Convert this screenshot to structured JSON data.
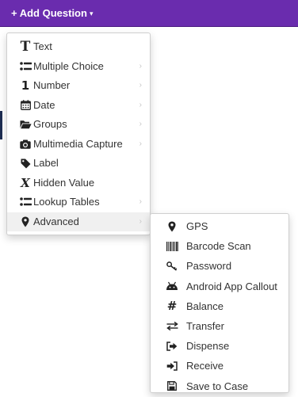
{
  "toolbar": {
    "add_question_label": "+ Add Question",
    "caret": "▾",
    "bar_color": "#6a2cae"
  },
  "menu": {
    "items": [
      {
        "label": "Text",
        "icon": "text-icon",
        "has_submenu": false
      },
      {
        "label": "Multiple Choice",
        "icon": "list-icon",
        "has_submenu": true
      },
      {
        "label": "Number",
        "icon": "number-icon",
        "has_submenu": true
      },
      {
        "label": "Date",
        "icon": "calendar-icon",
        "has_submenu": true
      },
      {
        "label": "Groups",
        "icon": "folder-open-icon",
        "has_submenu": true
      },
      {
        "label": "Multimedia Capture",
        "icon": "camera-icon",
        "has_submenu": true
      },
      {
        "label": "Label",
        "icon": "tag-icon",
        "has_submenu": false
      },
      {
        "label": "Hidden Value",
        "icon": "hidden-value-icon",
        "has_submenu": false
      },
      {
        "label": "Lookup Tables",
        "icon": "list-icon",
        "has_submenu": true
      },
      {
        "label": "Advanced",
        "icon": "map-marker-icon",
        "has_submenu": true,
        "active": true
      }
    ],
    "submenu_chevron": "›"
  },
  "advanced_submenu": {
    "items": [
      {
        "label": "GPS",
        "icon": "map-marker-icon"
      },
      {
        "label": "Barcode Scan",
        "icon": "barcode-icon"
      },
      {
        "label": "Password",
        "icon": "key-icon"
      },
      {
        "label": "Android App Callout",
        "icon": "android-icon"
      },
      {
        "label": "Balance",
        "icon": "hash-icon"
      },
      {
        "label": "Transfer",
        "icon": "exchange-icon"
      },
      {
        "label": "Dispense",
        "icon": "sign-out-icon"
      },
      {
        "label": "Receive",
        "icon": "sign-in-icon"
      },
      {
        "label": "Save to Case",
        "icon": "save-icon"
      }
    ]
  }
}
